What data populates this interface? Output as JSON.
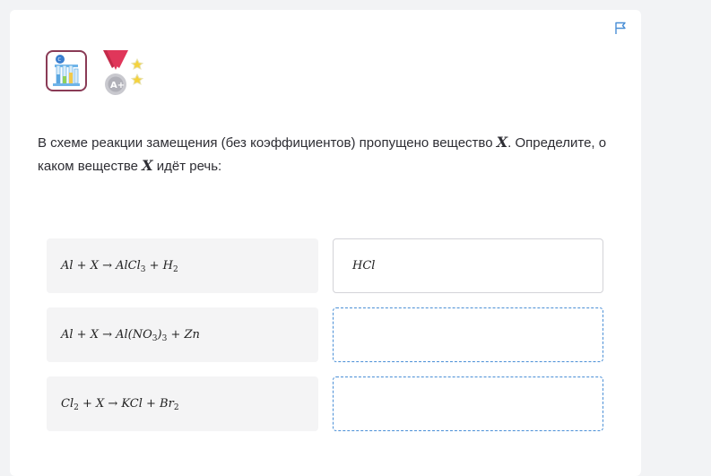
{
  "question": {
    "part1": "В схеме реакции замещения (без коэффициентов) пропущено вещество ",
    "var": "X",
    "part2": ". Определите, о каком веществе ",
    "part3": " идёт речь:"
  },
  "rows": [
    {
      "lhs": "Al + X → AlCl",
      "sub1": "3",
      "rhs": " + H",
      "sub2": "2",
      "tail": "",
      "answer": "HCl"
    },
    {
      "lhs": "Al + X → Al(NO",
      "sub1": "3",
      "rhs": ")",
      "sub2": "3",
      "tail": " + Zn",
      "answer": ""
    },
    {
      "lhs": "Cl",
      "sub1": "2",
      "rhs": " + X → KCl + Br",
      "sub2": "2",
      "tail": "",
      "answer": ""
    }
  ],
  "icons": {
    "flag": "flag-icon",
    "lab_badge": "lab-flasks-badge-icon",
    "medal_badge": "medal-badge-icon",
    "medal_text": "A+"
  },
  "colors": {
    "accent": "#4a8fd6",
    "badge_border": "#8a3b56",
    "medal_ribbon": "#e0365a",
    "star": "#f5d23c"
  }
}
